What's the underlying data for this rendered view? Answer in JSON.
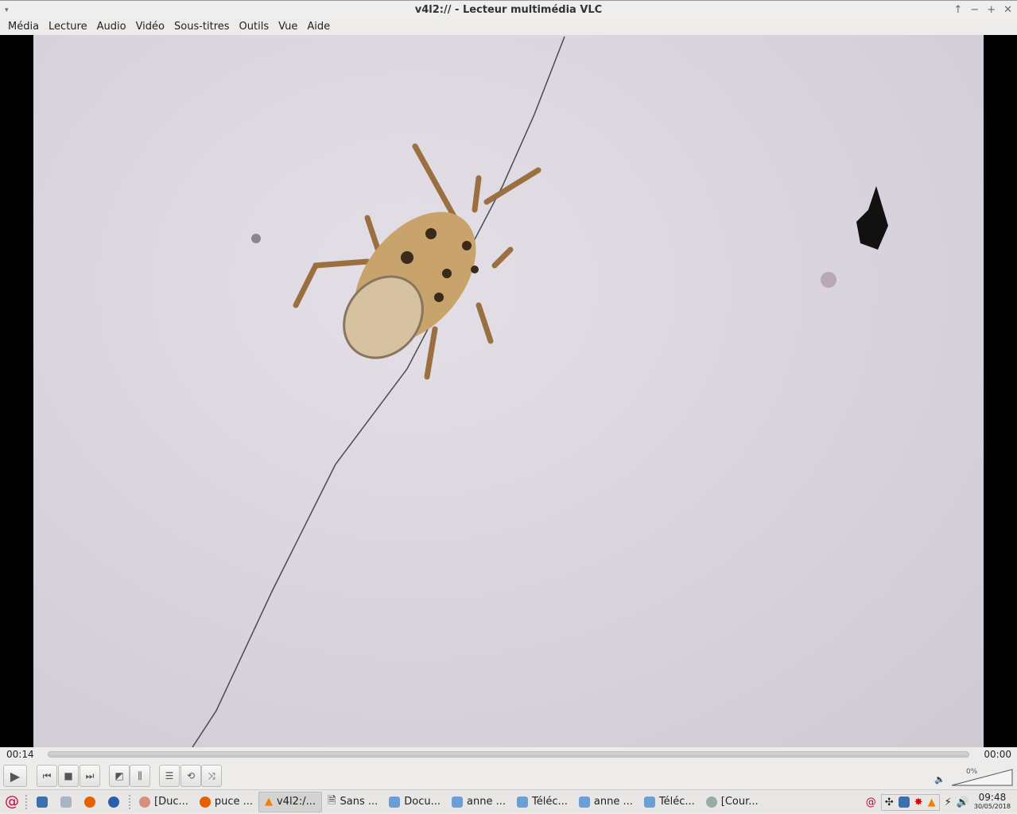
{
  "window": {
    "title": "v4l2:// - Lecteur multimédia VLC",
    "menu_arrow": "▾",
    "buttons": [
      "↑",
      "−",
      "+",
      "✕"
    ]
  },
  "menu": [
    "Média",
    "Lecture",
    "Audio",
    "Vidéo",
    "Sous-titres",
    "Outils",
    "Vue",
    "Aide"
  ],
  "player": {
    "current_time": "00:14",
    "total_time": "00:00",
    "progress": 0,
    "volume_label": "0%",
    "volume": 0
  },
  "taskbar": {
    "items": [
      "[Duc...",
      "puce ...",
      "v4l2:/...",
      "Sans ...",
      "Docu...",
      "anne ...",
      "Téléc...",
      "anne ...",
      "Téléc...",
      "[Cour..."
    ],
    "active_index": 2,
    "clock_time": "09:48",
    "clock_date": "30/05/2018"
  }
}
